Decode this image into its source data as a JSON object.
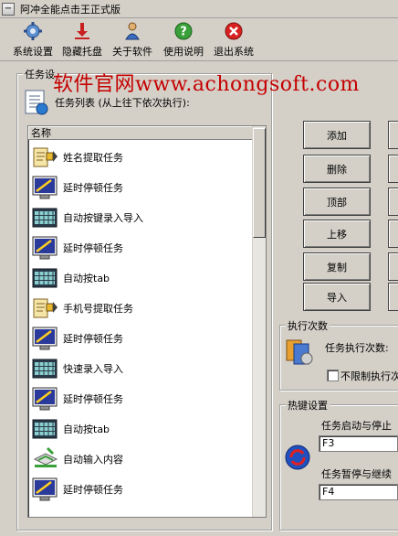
{
  "window": {
    "title": "阿冲全能点击王正式版"
  },
  "toolbar": {
    "items": [
      {
        "label": "系统设置",
        "icon": "gear-icon"
      },
      {
        "label": "隐藏托盘",
        "icon": "download-arrow-icon"
      },
      {
        "label": "关于软件",
        "icon": "person-icon"
      },
      {
        "label": "使用说明",
        "icon": "help-icon"
      },
      {
        "label": "退出系统",
        "icon": "exit-icon"
      }
    ]
  },
  "watermark": "软件官网www.achongsoft.com",
  "task_settings": {
    "group_label": "任务设",
    "list_caption": "任务列表 (从上往下依次执行):",
    "column_header": "名称",
    "tasks": [
      {
        "label": "姓名提取任务",
        "icon": "extract-task-icon"
      },
      {
        "label": "延时停顿任务",
        "icon": "delay-monitor-icon"
      },
      {
        "label": "自动按键录入导入",
        "icon": "keyboard-icon"
      },
      {
        "label": "延时停顿任务",
        "icon": "delay-monitor-icon"
      },
      {
        "label": "自动按tab",
        "icon": "keyboard-icon"
      },
      {
        "label": "手机号提取任务",
        "icon": "extract-task-icon"
      },
      {
        "label": "延时停顿任务",
        "icon": "delay-monitor-icon"
      },
      {
        "label": "快速录入导入",
        "icon": "keyboard-icon"
      },
      {
        "label": "延时停顿任务",
        "icon": "delay-monitor-icon"
      },
      {
        "label": "自动按tab",
        "icon": "keyboard-icon"
      },
      {
        "label": "自动输入内容",
        "icon": "input-content-icon"
      },
      {
        "label": "延时停顿任务",
        "icon": "delay-monitor-icon"
      }
    ]
  },
  "buttons": {
    "add": "添加",
    "delete": "删除",
    "top": "顶部",
    "move_up": "上移",
    "copy": "复制",
    "import": "导入"
  },
  "exec_count": {
    "group_label": "执行次数",
    "label": "任务执行次数:",
    "unlimited_label": "不限制执行次"
  },
  "hotkey": {
    "group_label": "热键设置",
    "start_stop_label": "任务启动与停止",
    "start_stop_value": "F3",
    "pause_label": "任务暂停与继续",
    "pause_value": "F4"
  }
}
